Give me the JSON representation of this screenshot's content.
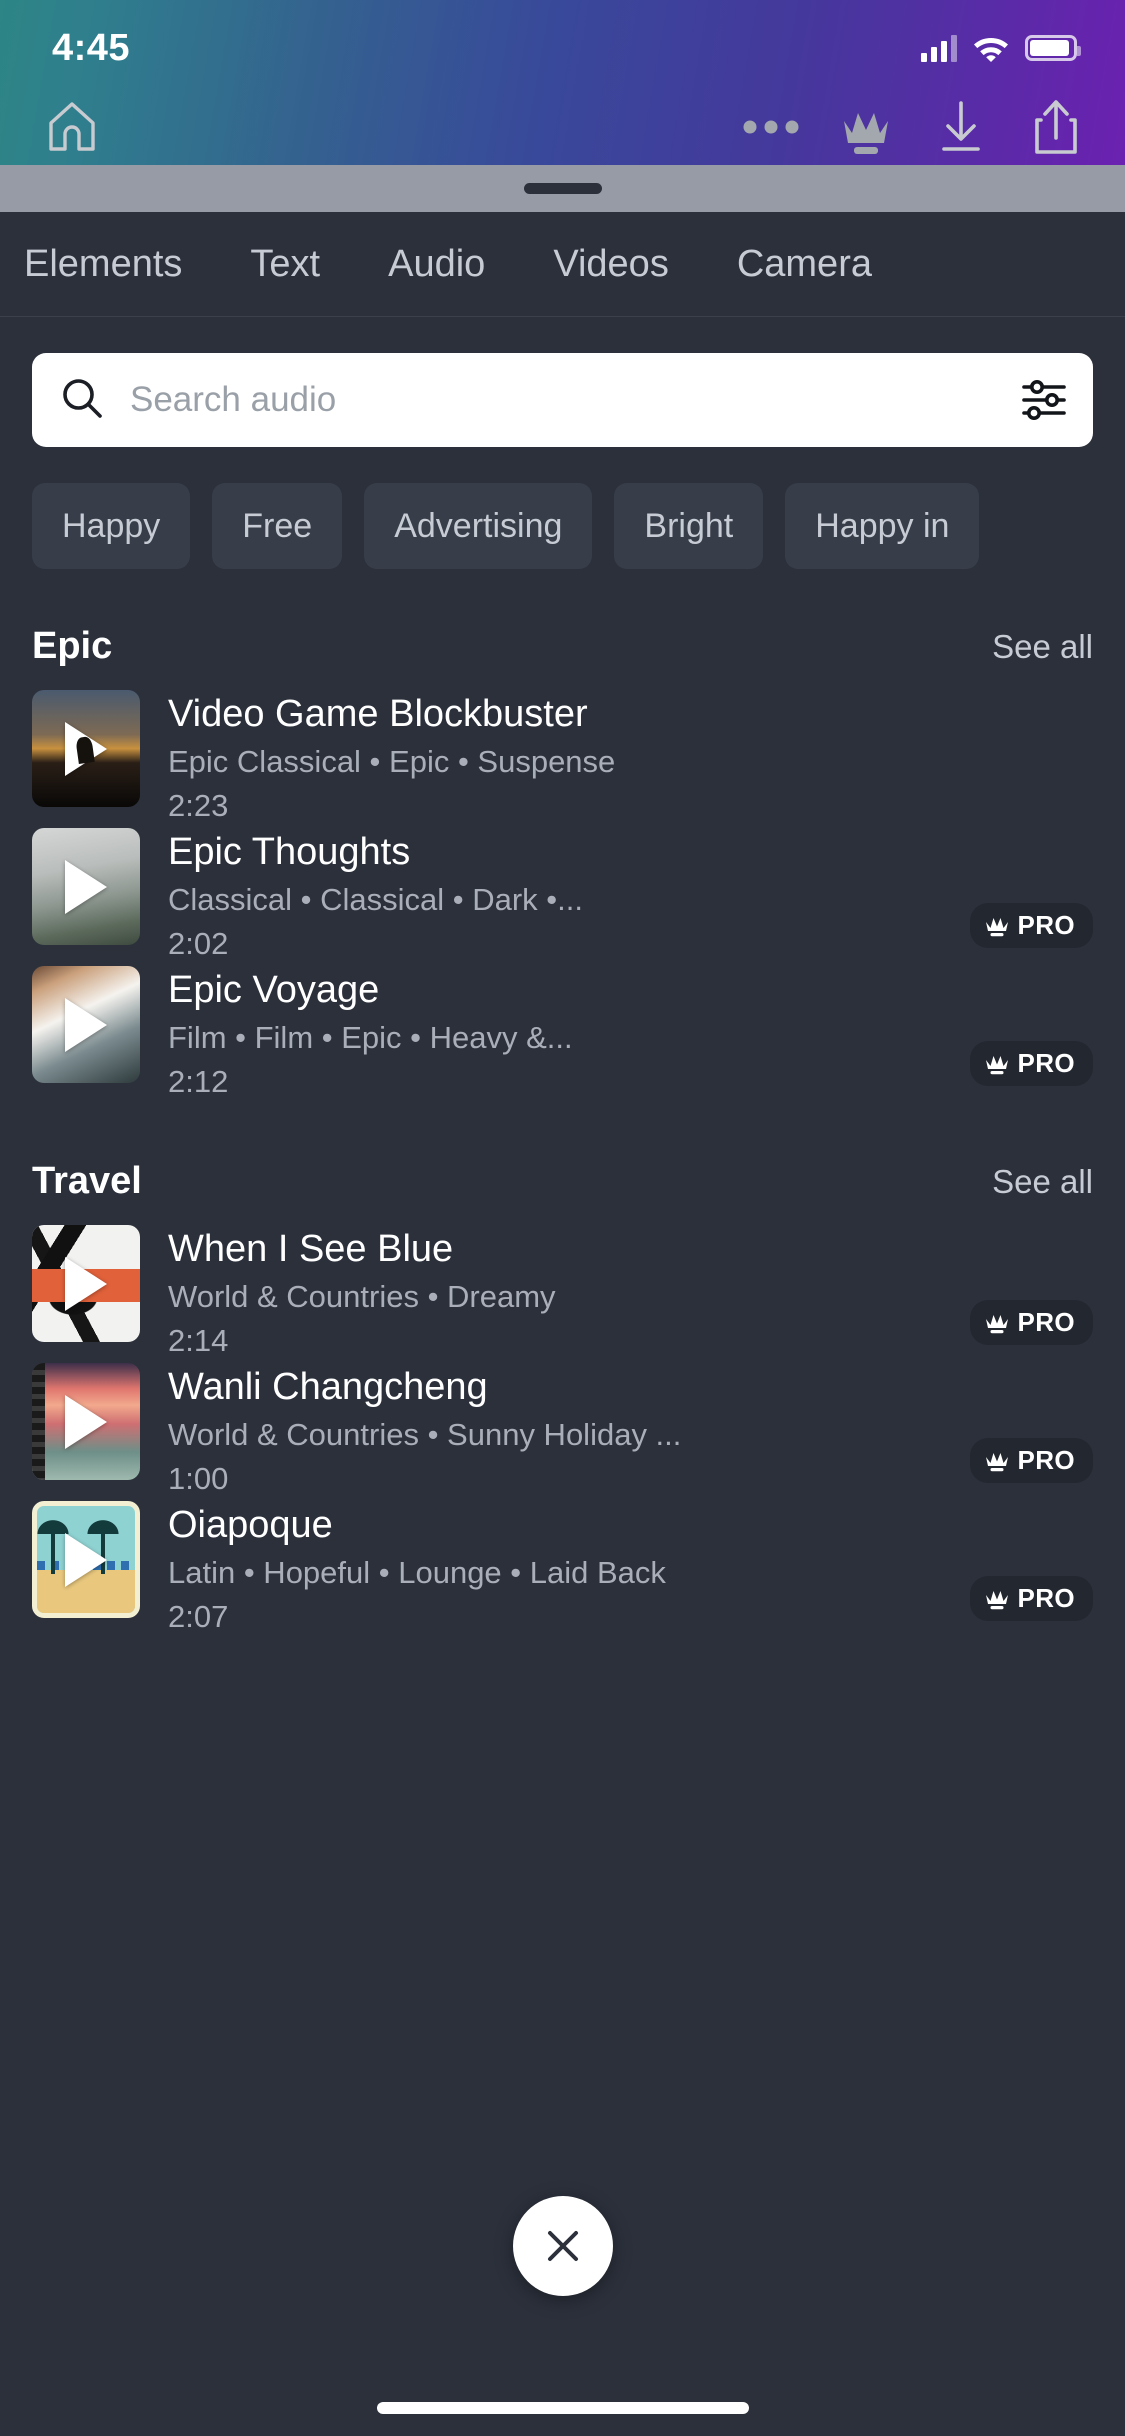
{
  "status_bar": {
    "time": "4:45",
    "signal_icon": "cellular-signal-icon",
    "wifi_icon": "wifi-icon",
    "battery_icon": "battery-icon"
  },
  "toolbar": {
    "home_icon": "home-icon",
    "more_icon": "more-options-icon",
    "pro_crown_icon": "crown-icon",
    "download_icon": "download-icon",
    "share_icon": "share-icon"
  },
  "sheet": {
    "drag_handle": "drag-handle",
    "tabs": [
      {
        "label": "Elements",
        "active": false
      },
      {
        "label": "Text",
        "active": false
      },
      {
        "label": "Audio",
        "active": true
      },
      {
        "label": "Videos",
        "active": false
      },
      {
        "label": "Camera",
        "active": false
      }
    ],
    "search": {
      "placeholder": "Search audio",
      "value": "",
      "search_icon": "search-icon",
      "filter_icon": "filter-sliders-icon"
    },
    "chips": [
      "Happy",
      "Free",
      "Advertising",
      "Bright",
      "Happy in"
    ],
    "see_all_label": "See all",
    "pro_badge_label": "PRO",
    "sections": [
      {
        "title": "Epic",
        "tracks": [
          {
            "name": "Video Game Blockbuster",
            "tags": "Epic Classical • Epic • Suspense",
            "duration": "2:23",
            "pro": false,
            "art": "art-vgb"
          },
          {
            "name": "Epic Thoughts",
            "tags": "Classical • Classical • Dark •...",
            "duration": "2:02",
            "pro": true,
            "art": "art-et"
          },
          {
            "name": "Epic Voyage",
            "tags": "Film • Film • Epic • Heavy &...",
            "duration": "2:12",
            "pro": true,
            "art": "art-ev"
          }
        ]
      },
      {
        "title": "Travel",
        "tracks": [
          {
            "name": "When I See Blue",
            "tags": "World & Countries • Dreamy",
            "duration": "2:14",
            "pro": true,
            "art": "art-wisb"
          },
          {
            "name": "Wanli Changcheng",
            "tags": "World & Countries • Sunny Holiday ...",
            "duration": "1:00",
            "pro": true,
            "art": "art-wc"
          },
          {
            "name": "Oiapoque",
            "tags": "Latin • Hopeful • Lounge • Laid Back",
            "duration": "2:07",
            "pro": true,
            "art": "art-oia"
          }
        ]
      }
    ],
    "close_button_icon": "close-x-icon"
  },
  "colors": {
    "sheet_bg": "#2b303b",
    "chip_bg": "#373d49",
    "pro_badge_bg": "#23272f",
    "handle_strip": "#969ba5",
    "accent_orange": "#e0613a"
  }
}
